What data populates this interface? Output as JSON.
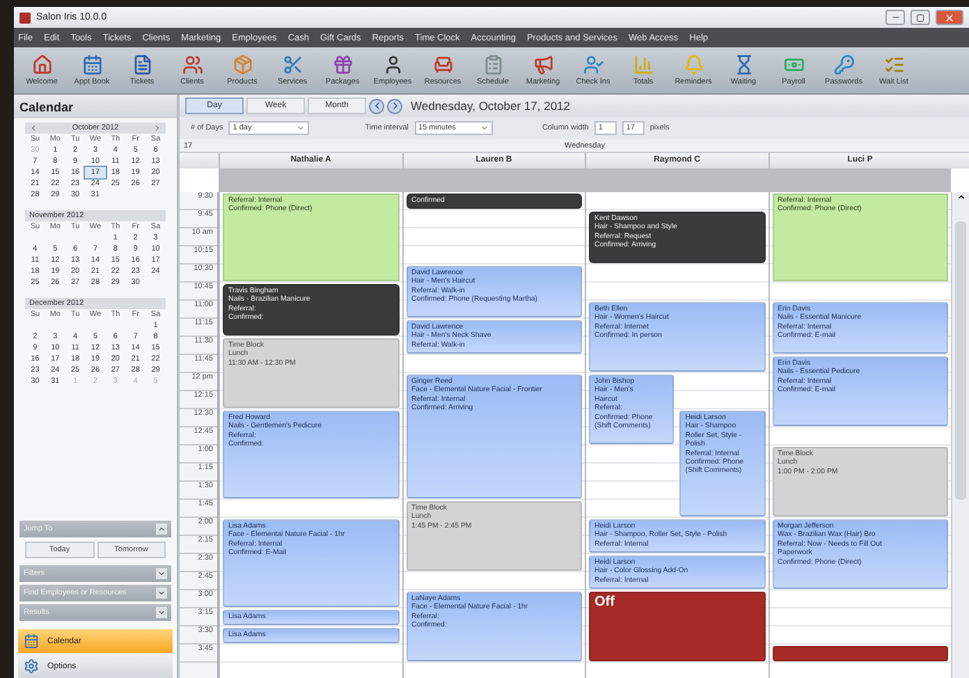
{
  "window": {
    "title": "Salon Iris 10.0.0"
  },
  "menu": [
    "File",
    "Edit",
    "Tools",
    "Tickets",
    "Clients",
    "Marketing",
    "Employees",
    "Cash",
    "Gift Cards",
    "Reports",
    "Time Clock",
    "Accounting",
    "Products and Services",
    "Web Access",
    "Help"
  ],
  "toolbar": [
    "Welcome",
    "Appt Book",
    "Tickets",
    "Clients",
    "Products",
    "Services",
    "Packages",
    "Employees",
    "Resources",
    "Schedule",
    "Marketing",
    "Check Ins",
    "Totals",
    "Reminders",
    "Waiting",
    "Payroll",
    "Passwords",
    "Wait List"
  ],
  "sidebar": {
    "title": "Calendar",
    "months": [
      {
        "title": "October 2012",
        "nav": true,
        "weekdays": [
          "Su",
          "Mo",
          "Tu",
          "We",
          "Th",
          "Fr",
          "Sa"
        ],
        "weeks": [
          [
            {
              "d": "30",
              "outside": true
            },
            "1",
            "2",
            "3",
            "4",
            "5",
            "6"
          ],
          [
            "7",
            "8",
            "9",
            "10",
            "11",
            "12",
            "13"
          ],
          [
            "14",
            "15",
            "16",
            {
              "d": "17",
              "selected": true
            },
            "18",
            "19",
            "20"
          ],
          [
            "21",
            "22",
            "23",
            "24",
            "25",
            "26",
            "27"
          ],
          [
            "28",
            "29",
            "30",
            "31"
          ]
        ]
      },
      {
        "title": "November 2012",
        "nav": false,
        "weekdays": [
          "Su",
          "Mo",
          "Tu",
          "We",
          "Th",
          "Fr",
          "Sa"
        ],
        "weeks": [
          [
            "1",
            "2",
            "3"
          ],
          [
            "4",
            "5",
            "6",
            "7",
            "8",
            "9",
            "10"
          ],
          [
            "11",
            "12",
            "13",
            "14",
            "15",
            "16",
            "17"
          ],
          [
            "18",
            "19",
            "20",
            "21",
            "22",
            "23",
            "24"
          ],
          [
            "25",
            "26",
            "27",
            "28",
            "29",
            "30"
          ]
        ]
      },
      {
        "title": "December 2012",
        "nav": false,
        "weekdays": [
          "Su",
          "Mo",
          "Tu",
          "We",
          "Th",
          "Fr",
          "Sa"
        ],
        "weeks": [
          [
            "1"
          ],
          [
            "2",
            "3",
            "4",
            "5",
            "6",
            "7",
            "8"
          ],
          [
            "9",
            "10",
            "11",
            "12",
            "13",
            "14",
            "15"
          ],
          [
            "16",
            "17",
            "18",
            "19",
            "20",
            "21",
            "22"
          ],
          [
            "23",
            "24",
            "25",
            "26",
            "27",
            "28",
            "29"
          ],
          [
            "30",
            "31",
            {
              "d": "1",
              "outside": true
            },
            {
              "d": "2",
              "outside": true
            },
            {
              "d": "3",
              "outside": true
            },
            {
              "d": "4",
              "outside": true
            },
            {
              "d": "5",
              "outside": true
            }
          ]
        ]
      }
    ],
    "jump": {
      "title": "Jump To",
      "buttons": [
        "Today",
        "Tomorrow"
      ]
    },
    "sections": [
      "Filters",
      "Find Employees or Resources",
      "Results"
    ],
    "nav": [
      {
        "label": "Calendar",
        "selected": true
      },
      {
        "label": "Options",
        "selected": false
      }
    ]
  },
  "view_tabs": [
    {
      "label": "Day",
      "selected": true
    },
    {
      "label": "Week",
      "selected": false
    },
    {
      "label": "Month",
      "selected": false
    }
  ],
  "date": "Wednesday, October 17, 2012",
  "options": {
    "days_label": "# of Days",
    "days": "1 day",
    "interval_label": "Time interval",
    "interval": "15 minutes",
    "width_label": "Column width",
    "width_from": "1",
    "width_to": "17",
    "width_unit": "pixels"
  },
  "schedule": {
    "day_number": "17",
    "day_name": "Wednesday",
    "times": [
      "9:30",
      "9:45",
      "10 am",
      "10:15",
      "10:30",
      "10:45",
      "11:00",
      "11:15",
      "11:30",
      "11:45",
      "12 pm",
      "12:15",
      "12:30",
      "12:45",
      "1:00",
      "1:15",
      "1:30",
      "1:45",
      "2:00",
      "2:15",
      "2:30",
      "2:45",
      "3:00",
      "3:15",
      "3:30",
      "3:45"
    ],
    "columns": [
      {
        "name": "Nathalie A",
        "lanes": [
          [
            {
              "kind": "checked-in",
              "lines": [
                "Referral: Internal",
                "Confirmed: Phone (Direct)"
              ]
            },
            {
              "kind": "cont"
            },
            {
              "kind": "cont"
            },
            {
              "kind": "cont"
            },
            {
              "kind": "cont"
            },
            {
              "kind": "in-service",
              "lines": [
                "Travis Bingham",
                "Nails - Brazilian Manicure",
                "Referral:",
                "Confirmed:"
              ]
            },
            {
              "kind": "cont"
            },
            {
              "kind": "cont"
            },
            {
              "kind": "time-block",
              "lines": [
                "Time Block",
                "Lunch",
                "11:30 AM - 12:30 PM"
              ]
            },
            {
              "kind": "cont"
            },
            {
              "kind": "cont"
            },
            {
              "kind": "cont"
            },
            {
              "kind": "booked",
              "lines": [
                "Fred Howard",
                "Nails - Gentlemen's Pedicure",
                "Referral:",
                "Confirmed:"
              ]
            },
            {
              "kind": "cont"
            },
            {
              "kind": "cont"
            },
            {
              "kind": "cont"
            },
            {
              "kind": "cont"
            },
            {
              "kind": "free"
            },
            {
              "kind": "booked",
              "lines": [
                "Lisa Adams",
                "Face - Elemental Nature Facial - 1hr",
                "Referral: Internal",
                "Confirmed: E-Mail"
              ]
            },
            {
              "kind": "cont"
            },
            {
              "kind": "cont"
            },
            {
              "kind": "cont"
            },
            {
              "kind": "cont"
            },
            {
              "kind": "booked",
              "lines": [
                "Lisa Adams"
              ]
            },
            {
              "kind": "booked",
              "lines": [
                "Lisa Adams"
              ]
            },
            {
              "kind": "free"
            }
          ]
        ]
      },
      {
        "name": "Lauren B",
        "lanes": [
          [
            {
              "kind": "in-service",
              "lines": [
                "Confirmed"
              ]
            },
            {
              "kind": "free"
            },
            {
              "kind": "free"
            },
            {
              "kind": "free"
            },
            {
              "kind": "booked",
              "lines": [
                "David Lawrence",
                "Hair - Men's Haircut",
                "Referral: Walk-in",
                "Confirmed: Phone (Requesting Martha)"
              ]
            },
            {
              "kind": "cont"
            },
            {
              "kind": "cont"
            },
            {
              "kind": "booked",
              "lines": [
                "David Lawrence",
                "Hair - Men's Neck Shave",
                "Referral: Walk-in"
              ]
            },
            {
              "kind": "cont"
            },
            {
              "kind": "free"
            },
            {
              "kind": "booked",
              "lines": [
                "Ginger Reed",
                "Face - Elemental Nature Facial - Frontier",
                "Referral: Internal",
                "Confirmed: Arriving"
              ]
            },
            {
              "kind": "cont"
            },
            {
              "kind": "cont"
            },
            {
              "kind": "cont"
            },
            {
              "kind": "cont"
            },
            {
              "kind": "cont"
            },
            {
              "kind": "cont"
            },
            {
              "kind": "time-block",
              "lines": [
                "Time Block",
                "Lunch",
                "1:45 PM - 2:45 PM"
              ]
            },
            {
              "kind": "cont"
            },
            {
              "kind": "cont"
            },
            {
              "kind": "cont"
            },
            {
              "kind": "free"
            },
            {
              "kind": "booked",
              "lines": [
                "LaNaye Adams",
                "Face - Elemental Nature Facial - 1hr",
                "Referral:",
                "Confirmed:"
              ]
            },
            {
              "kind": "cont"
            },
            {
              "kind": "cont"
            },
            {
              "kind": "cont"
            }
          ]
        ]
      },
      {
        "name": "Raymond C",
        "lanes": [
          [
            {
              "kind": "free"
            },
            {
              "kind": "in-service",
              "wide": true,
              "lines": [
                "Kent Dawson",
                "Hair - Shampoo and Style",
                "Referral: Request",
                "Confirmed: Arriving"
              ]
            },
            {
              "kind": "cont"
            },
            {
              "kind": "cont"
            },
            {
              "kind": "free"
            },
            {
              "kind": "free"
            },
            {
              "kind": "booked",
              "wide": true,
              "lines": [
                "Beth Ellen",
                "Hair - Women's Haircut",
                "Referral: Internet",
                "Confirmed: In person"
              ]
            },
            {
              "kind": "cont"
            },
            {
              "kind": "cont"
            },
            {
              "kind": "cont"
            },
            {
              "kind": "booked",
              "wide": false,
              "lines": [
                "John Bishop",
                "Hair - Men's",
                "Haircut",
                "Referral:",
                "Confirmed: Phone",
                "(Shift Comments)"
              ]
            },
            {
              "kind": "cont"
            },
            {
              "kind": "cont"
            },
            {
              "kind": "cont"
            },
            {
              "kind": "free"
            },
            {
              "kind": "free"
            },
            {
              "kind": "free"
            },
            {
              "kind": "free"
            },
            {
              "kind": "booked",
              "wide": true,
              "lines": [
                "Heidi Larson",
                "Hair - Shampoo, Roller Set, Style - Polish",
                "Referral: Internal"
              ]
            },
            {
              "kind": "cont"
            },
            {
              "kind": "booked",
              "wide": true,
              "lines": [
                "Heidi Larson",
                "Hair - Color Glossing Add-On",
                "Referral: Internal"
              ]
            },
            {
              "kind": "cont"
            },
            {
              "kind": "off",
              "wide": true,
              "lines": [
                "Off"
              ]
            },
            {
              "kind": "cont"
            },
            {
              "kind": "cont"
            },
            {
              "kind": "cont"
            }
          ],
          [
            {
              "kind": "free"
            },
            {
              "kind": "free"
            },
            {
              "kind": "free"
            },
            {
              "kind": "free"
            },
            {
              "kind": "free"
            },
            {
              "kind": "free"
            },
            {
              "kind": "free"
            },
            {
              "kind": "free"
            },
            {
              "kind": "free"
            },
            {
              "kind": "free"
            },
            {
              "kind": "free"
            },
            {
              "kind": "free"
            },
            {
              "kind": "booked",
              "wide": false,
              "lines": [
                "Heidi Larson",
                "Hair - Shampoo",
                "Roller Set, Style -",
                "Polish",
                "Referral: Internal",
                "Confirmed: Phone",
                "(Shift Comments)"
              ]
            },
            {
              "kind": "cont"
            },
            {
              "kind": "cont"
            },
            {
              "kind": "cont"
            },
            {
              "kind": "cont"
            },
            {
              "kind": "cont"
            },
            {
              "kind": "free"
            },
            {
              "kind": "free"
            },
            {
              "kind": "free"
            },
            {
              "kind": "free"
            },
            {
              "kind": "free"
            },
            {
              "kind": "free"
            },
            {
              "kind": "free"
            },
            {
              "kind": "free"
            }
          ]
        ]
      },
      {
        "name": "Luci P",
        "lanes": [
          [
            {
              "kind": "checked-in",
              "lines": [
                "Referral: Internal",
                "Confirmed: Phone (Direct)"
              ]
            },
            {
              "kind": "cont"
            },
            {
              "kind": "cont"
            },
            {
              "kind": "cont"
            },
            {
              "kind": "cont"
            },
            {
              "kind": "free"
            },
            {
              "kind": "booked",
              "lines": [
                "Erin Davis",
                "Nails - Essential Manicure",
                "Referral: Internal",
                "Confirmed: E-mail"
              ]
            },
            {
              "kind": "cont"
            },
            {
              "kind": "cont"
            },
            {
              "kind": "booked",
              "lines": [
                "Erin Davis",
                "Nails - Essential Pedicure",
                "Referral: Internal",
                "Confirmed: E-mail"
              ]
            },
            {
              "kind": "cont"
            },
            {
              "kind": "cont"
            },
            {
              "kind": "cont"
            },
            {
              "kind": "free"
            },
            {
              "kind": "time-block",
              "lines": [
                "Time Block",
                "Lunch",
                "1:00 PM - 2:00 PM"
              ]
            },
            {
              "kind": "cont"
            },
            {
              "kind": "cont"
            },
            {
              "kind": "cont"
            },
            {
              "kind": "booked",
              "lines": [
                "Morgan Jefferson",
                "Wax - Brazilian Wax (Hair) Bro",
                "Referral: Now - Needs to Fill Out",
                "Paperwork",
                "Confirmed: Phone (Direct)"
              ]
            },
            {
              "kind": "cont"
            },
            {
              "kind": "cont"
            },
            {
              "kind": "cont"
            },
            {
              "kind": "free"
            },
            {
              "kind": "free"
            },
            {
              "kind": "free"
            },
            {
              "kind": "off"
            }
          ]
        ]
      }
    ]
  }
}
